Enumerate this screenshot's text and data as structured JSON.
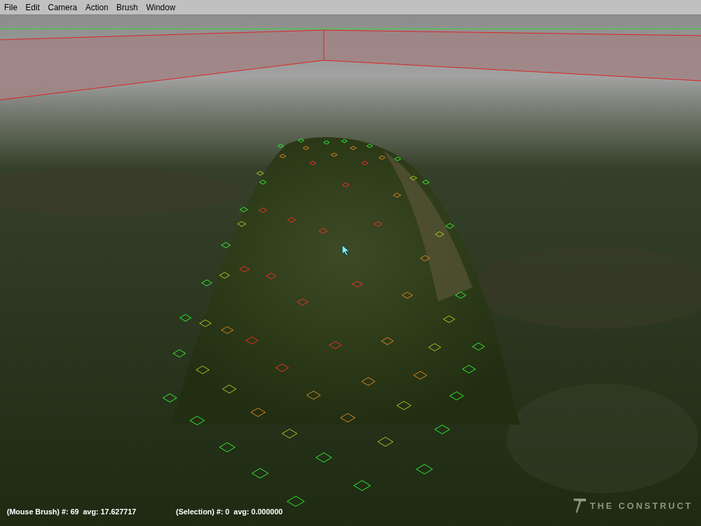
{
  "menu_bar": [
    "File",
    "Edit",
    "Camera",
    "Action",
    "Brush",
    "Window"
  ],
  "status": {
    "mouse_brush": "(Mouse Brush) #: 69  avg: 17.627717",
    "selection": "(Selection) #: 0  avg: 0.000000"
  },
  "watermark_logo": {
    "text": "THE CONSTRUCT"
  }
}
